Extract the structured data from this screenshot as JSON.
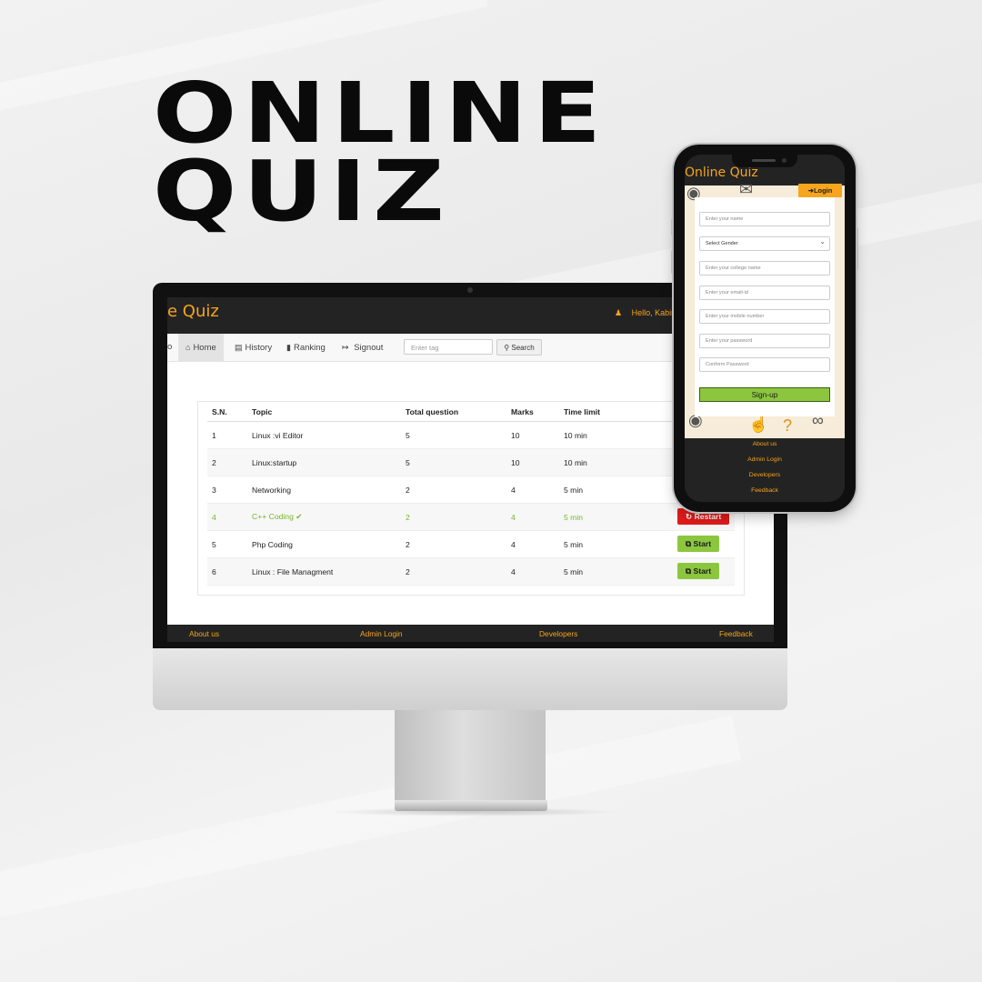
{
  "headline": {
    "line1": "ONLINE",
    "line2": "QUIZ"
  },
  "colors": {
    "accent": "#f6a51c",
    "dark": "#232323",
    "success": "#8cc63f",
    "danger": "#e21b1b"
  },
  "desktop": {
    "brand": "e Quiz",
    "greeting": "Hello,",
    "user": "Kabin",
    "nav": {
      "prev": "o",
      "home": "Home",
      "history": "History",
      "ranking": "Ranking",
      "signout": "Signout"
    },
    "search": {
      "placeholder": "Enter tag",
      "button": "Search"
    },
    "table": {
      "headers": [
        "S.N.",
        "Topic",
        "Total question",
        "Marks",
        "Time limit"
      ],
      "rows": [
        {
          "sn": "1",
          "topic": "Linux :vi Editor",
          "total": "5",
          "marks": "10",
          "time": "10 min",
          "action": ""
        },
        {
          "sn": "2",
          "topic": "Linux:startup",
          "total": "5",
          "marks": "10",
          "time": "10 min",
          "action": ""
        },
        {
          "sn": "3",
          "topic": "Networking",
          "total": "2",
          "marks": "4",
          "time": "5 min",
          "action": ""
        },
        {
          "sn": "4",
          "topic": "C++ Coding",
          "total": "2",
          "marks": "4",
          "time": "5 min",
          "action": "Restart"
        },
        {
          "sn": "5",
          "topic": "Php Coding",
          "total": "2",
          "marks": "4",
          "time": "5 min",
          "action": "Start"
        },
        {
          "sn": "6",
          "topic": "Linux : File Managment",
          "total": "2",
          "marks": "4",
          "time": "5 min",
          "action": "Start"
        }
      ]
    },
    "footer": [
      "About us",
      "Admin Login",
      "Developers",
      "Feedback"
    ]
  },
  "mobile": {
    "brand": "Online Quiz",
    "login": "Login",
    "fields": {
      "name": "Enter your name",
      "gender": "Select Gender",
      "college": "Enter your college name",
      "email": "Enter your email-id",
      "mobile": "Enter your mobile number",
      "password": "Enter your password",
      "confirm": "Conform Password"
    },
    "signup": "Sign-up",
    "footer": [
      "About us",
      "Admin Login",
      "Developers",
      "Feedback"
    ]
  }
}
